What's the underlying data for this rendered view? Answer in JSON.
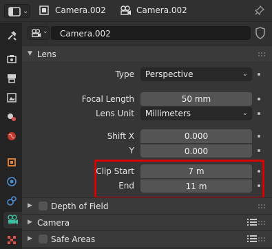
{
  "header": {
    "crumb1": "Camera.002",
    "crumb2": "Camera.002"
  },
  "object": {
    "name": "Camera.002"
  },
  "panels": {
    "lens": "Lens",
    "depth_of_field": "Depth of Field",
    "camera": "Camera",
    "safe_areas": "Safe Areas"
  },
  "lens": {
    "type_label": "Type",
    "type_value": "Perspective",
    "focal_length_label": "Focal Length",
    "focal_length_value": "50 mm",
    "lens_unit_label": "Lens Unit",
    "lens_unit_value": "Millimeters",
    "shift_x_label": "Shift X",
    "shift_x_value": "0.000",
    "shift_y_label": "Y",
    "shift_y_value": "0.000",
    "clip_start_label": "Clip Start",
    "clip_start_value": "7 m",
    "clip_end_label": "End",
    "clip_end_value": "11 m"
  },
  "colors": {
    "highlight": "#d90000",
    "active_tab_icon": "#3fbf9f"
  },
  "icons": [
    "editor-type-icon",
    "camera-object-icon",
    "camera-data-icon",
    "pin-icon",
    "tool-icon",
    "render-icon",
    "output-icon",
    "view-layer-icon",
    "scene-icon",
    "world-icon",
    "object-icon",
    "modifier-icon",
    "physics-icon",
    "camera-data-tab-icon",
    "texture-icon",
    "fake-user-shield-icon"
  ]
}
